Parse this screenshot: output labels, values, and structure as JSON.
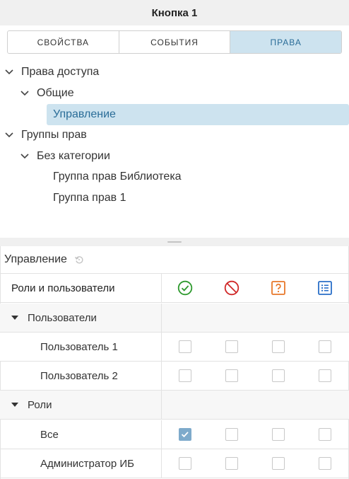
{
  "window": {
    "title": "Кнопка 1"
  },
  "tabs": [
    {
      "label": "СВОЙСТВА",
      "active": false
    },
    {
      "label": "СОБЫТИЯ",
      "active": false
    },
    {
      "label": "ПРАВА",
      "active": true
    }
  ],
  "tree": {
    "access_rights": "Права доступа",
    "general": "Общие",
    "management": "Управление",
    "rights_groups": "Группы прав",
    "no_category": "Без категории",
    "group_library": "Группа прав Библиотека",
    "group_1": "Группа прав 1"
  },
  "panel": {
    "title": "Управление",
    "column_header": "Роли и пользователи",
    "column_icons": [
      "allow-icon",
      "deny-icon",
      "undefined-icon",
      "list-icon"
    ],
    "colors": {
      "allow": "#2e9a2e",
      "deny": "#d02828",
      "undefined": "#e8782a",
      "list": "#2a6fc8",
      "checked": "#7eaacb"
    }
  },
  "rows": {
    "users_group": {
      "label": "Пользователи"
    },
    "user1": {
      "label": "Пользователь 1",
      "checks": [
        false,
        false,
        false,
        false
      ]
    },
    "user2": {
      "label": "Пользователь 2",
      "checks": [
        false,
        false,
        false,
        false
      ]
    },
    "roles_group": {
      "label": "Роли"
    },
    "all": {
      "label": "Все",
      "checks": [
        true,
        false,
        false,
        false
      ]
    },
    "admin": {
      "label": "Администратор ИБ",
      "checks": [
        false,
        false,
        false,
        false
      ]
    }
  }
}
